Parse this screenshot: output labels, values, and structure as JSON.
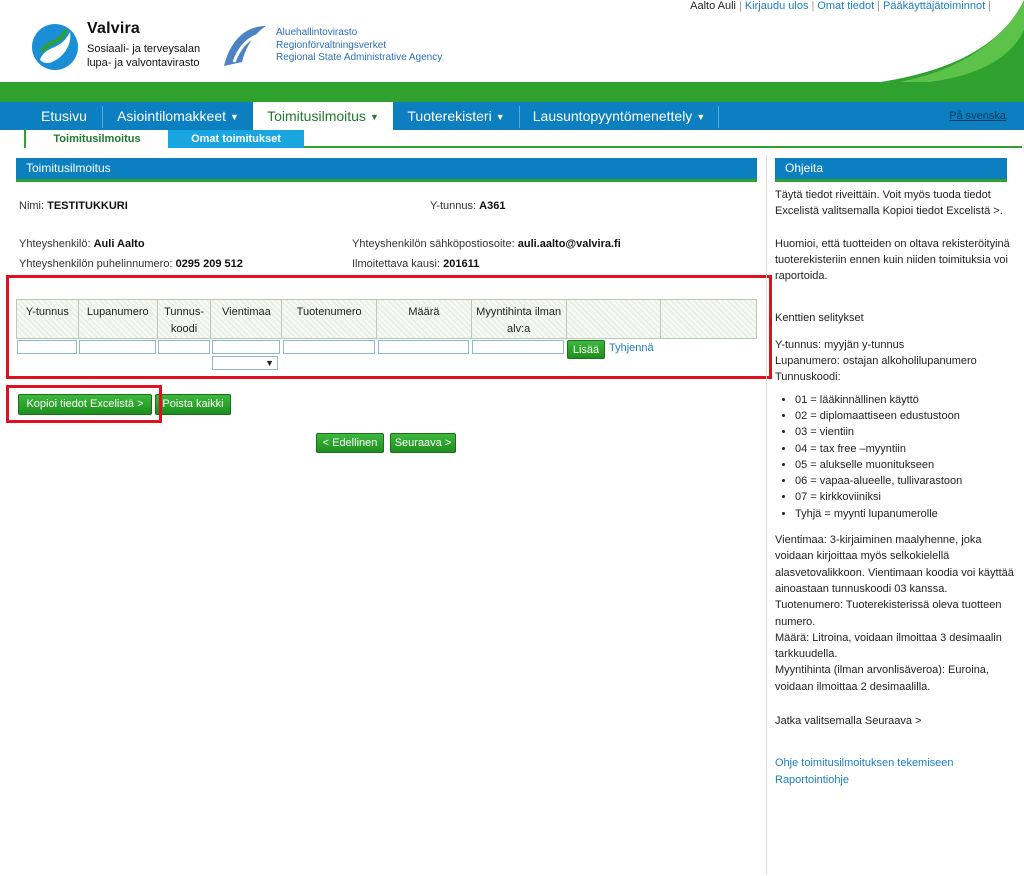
{
  "header": {
    "user_name": "Aalto Auli",
    "links": [
      "Kirjaudu ulos",
      "Omat tiedot",
      "Pääkäyttäjätoiminnot"
    ],
    "valvira_title": "Valvira",
    "valvira_sub1": "Sosiaali- ja terveysalan",
    "valvira_sub2": "lupa- ja valvontavirasto",
    "avi_line1": "Aluehallintovirasto",
    "avi_line2": "Regionförvaltningsverket",
    "avi_line3": "Regional State Administrative Agency"
  },
  "nav": {
    "items": [
      "Etusivu",
      "Asiointilomakkeet",
      "Toimitusilmoitus",
      "Tuoterekisteri",
      "Lausuntopyyntömenettely"
    ],
    "swedish": "På svenska"
  },
  "subnav": {
    "active": "Toimitusilmoitus",
    "inactive": "Omat toimitukset"
  },
  "main": {
    "title": "Toimitusilmoitus",
    "name_label": "Nimi:",
    "name_value": "TESTITUKKURI",
    "ytunnus_label": "Y-tunnus:",
    "ytunnus_value": "A361",
    "contact_label": "Yhteyshenkilö:",
    "contact_value": "Auli Aalto",
    "email_label": "Yhteyshenkilön sähköpostiosoite:",
    "email_value": "auli.aalto@valvira.fi",
    "phone_label": "Yhteyshenkilön puhelinnumero:",
    "phone_value": "0295 209 512",
    "period_label": "Ilmoitettava kausi:",
    "period_value": "201611"
  },
  "table": {
    "columns": [
      "Y-tunnus",
      "Lupanumero",
      "Tunnus-koodi",
      "Vientimaa",
      "Tuotenumero",
      "Määrä",
      "Myyntihinta ilman alv:a",
      "",
      ""
    ],
    "add_button": "Lisää",
    "clear_link": "Tyhjennä"
  },
  "actions": {
    "copy_excel": "Kopioi tiedot Excelistä >",
    "delete_all": "Poista kaikki",
    "prev": "< Edellinen",
    "next": "Seuraava >"
  },
  "sidebar": {
    "title": "Ohjeita",
    "p1": "Täytä tiedot riveittäin. Voit myös tuoda tiedot Excelistä valitsemalla Kopioi tiedot Excelistä >.",
    "p2": "Huomioi, että tuotteiden on oltava rekisteröityinä tuoterekisteriin ennen kuin niiden toimituksia voi raportoida.",
    "p3": "Kenttien selitykset",
    "p4a": "Y-tunnus: myyjän y-tunnus",
    "p4b": "Lupanumero: ostajan alkoholilupanumero",
    "p4c": "Tunnuskoodi:",
    "codes": [
      "01 = lääkinnällinen käyttö",
      "02 = diplomaattiseen edustustoon",
      "03 = vientiin",
      "04 = tax free –myyntiin",
      "05 = alukselle muonitukseen",
      "06 = vapaa-alueelle, tullivarastoon",
      "07 = kirkkoviiniksi",
      "Tyhjä = myynti lupanumerolle"
    ],
    "p5": "Vientimaa: 3-kirjaiminen maalyhenne, joka voidaan kirjoittaa myös selkokielellä alasvetovalikkoon. Vientimaan koodia voi käyttää ainoastaan tunnuskoodi 03 kanssa.",
    "p6": "Tuotenumero: Tuoterekisterissä oleva tuotteen numero.",
    "p7": "Määrä: Litroina, voidaan ilmoittaa 3 desimaalin tarkkuudella.",
    "p8": "Myyntihinta (ilman arvonlisäveroa): Euroina, voidaan ilmoittaa 2 desimaalilla.",
    "p9": "Jatka valitsemalla Seuraava >",
    "link1": "Ohje toimitusilmoituksen tekemiseen",
    "link2": "Raportointiohje"
  },
  "colors": {
    "nav_blue": "#0b7fc0",
    "green": "#2ea12e",
    "highlight_red": "#e0101f"
  }
}
